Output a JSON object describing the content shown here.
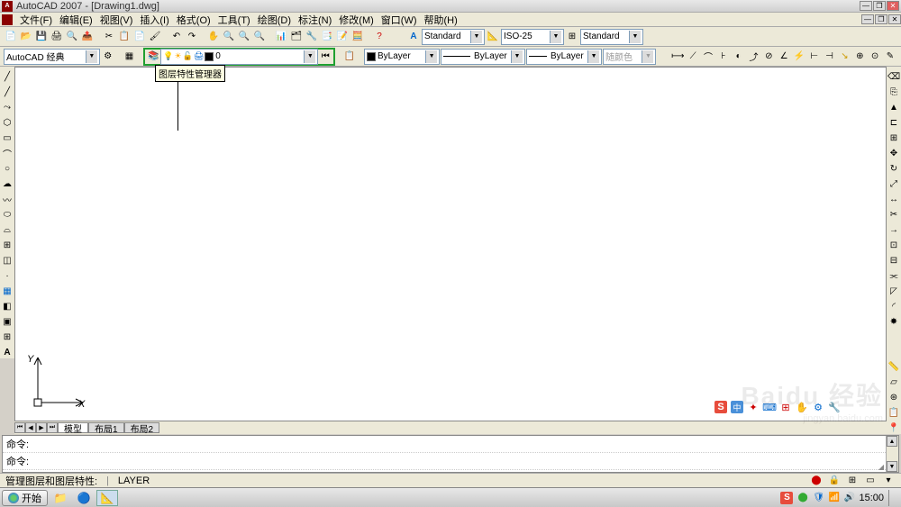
{
  "title": "AutoCAD 2007 - [Drawing1.dwg]",
  "menu": [
    "文件(F)",
    "编辑(E)",
    "视图(V)",
    "插入(I)",
    "格式(O)",
    "工具(T)",
    "绘图(D)",
    "标注(N)",
    "修改(M)",
    "窗口(W)",
    "帮助(H)"
  ],
  "workspace": "AutoCAD 经典",
  "text_style": "Standard",
  "dim_style": "ISO-25",
  "table_style": "Standard",
  "layer": {
    "name": "0"
  },
  "tooltip": "图层特性管理器",
  "linetype_control": "ByLayer",
  "lineweight_control": "ByLayer",
  "color_control": "ByLayer",
  "plot_style": "随颜色",
  "tabs": {
    "nav": [
      "⏮",
      "◀",
      "▶",
      "⏭"
    ],
    "model": "模型",
    "layout1": "布局1",
    "layout2": "布局2"
  },
  "command": {
    "line1": "命令:",
    "line2": "命令:"
  },
  "status": {
    "hint": "管理图层和图层特性:",
    "cmd": "LAYER"
  },
  "ucs": {
    "x": "X",
    "y": "Y"
  },
  "taskbar": {
    "start": "开始",
    "clock": "15:00"
  },
  "tray_s": "S",
  "tray_cn": "中",
  "watermark": "Baidu 经验",
  "watermark_sub": "jingyan.baidu.com"
}
